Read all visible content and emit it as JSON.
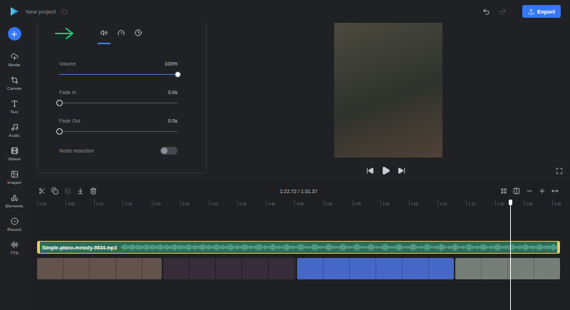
{
  "topbar": {
    "project_name": "New project",
    "undo": {
      "disabled": false
    },
    "redo": {
      "disabled": true
    },
    "export": "Export"
  },
  "sidebar": {
    "items": [
      {
        "label": "Media"
      },
      {
        "label": "Canvas"
      },
      {
        "label": "Text"
      },
      {
        "label": "Audio"
      },
      {
        "label": "Videos"
      },
      {
        "label": "Images"
      },
      {
        "label": "Elements"
      },
      {
        "label": "Record"
      },
      {
        "label": "TTS"
      }
    ]
  },
  "panel": {
    "tabs": [
      {
        "selected": true
      },
      {
        "selected": false
      },
      {
        "selected": false
      }
    ],
    "controls": [
      {
        "kind": "slider",
        "label": "Volume",
        "reading": "100%",
        "level": 1
      },
      {
        "kind": "slider",
        "label": "Fade In",
        "reading": "0.0s",
        "level": 0
      },
      {
        "kind": "slider",
        "label": "Fade Out",
        "reading": "0.0s",
        "level": 0
      },
      {
        "kind": "toggle",
        "label": "Noise reduction",
        "on": false
      }
    ]
  },
  "preview": {
    "playing": false
  },
  "timeline": {
    "tools": [
      {
        "disabled": false
      },
      {
        "disabled": false
      },
      {
        "disabled": true
      },
      {
        "disabled": false
      },
      {
        "disabled": false
      }
    ],
    "current_time": "1:22.72",
    "separator": "/",
    "total_time": "1:31.37",
    "ruler": [
      "0:00",
      "0:05",
      "0:10",
      "0:15",
      "0:20",
      "0:25",
      "0:30",
      "0:35",
      "0:40",
      "0:45",
      "0:50",
      "0:55",
      "1:00",
      "1:05",
      "1:10",
      "1:15",
      "1:20",
      "1:25",
      "1:30"
    ],
    "playhead": {
      "level": 0.905
    },
    "audio_track": {
      "name": "Simple-piano-melody-9834.mp3",
      "selected": true
    },
    "video_clips": [
      {
        "color": "#5a4741",
        "selected": false
      },
      {
        "color": "#2b1f2e",
        "selected": false
      },
      {
        "color": "#3a5fc2",
        "selected": false
      },
      {
        "color": "#6c766f",
        "selected": false
      }
    ]
  }
}
